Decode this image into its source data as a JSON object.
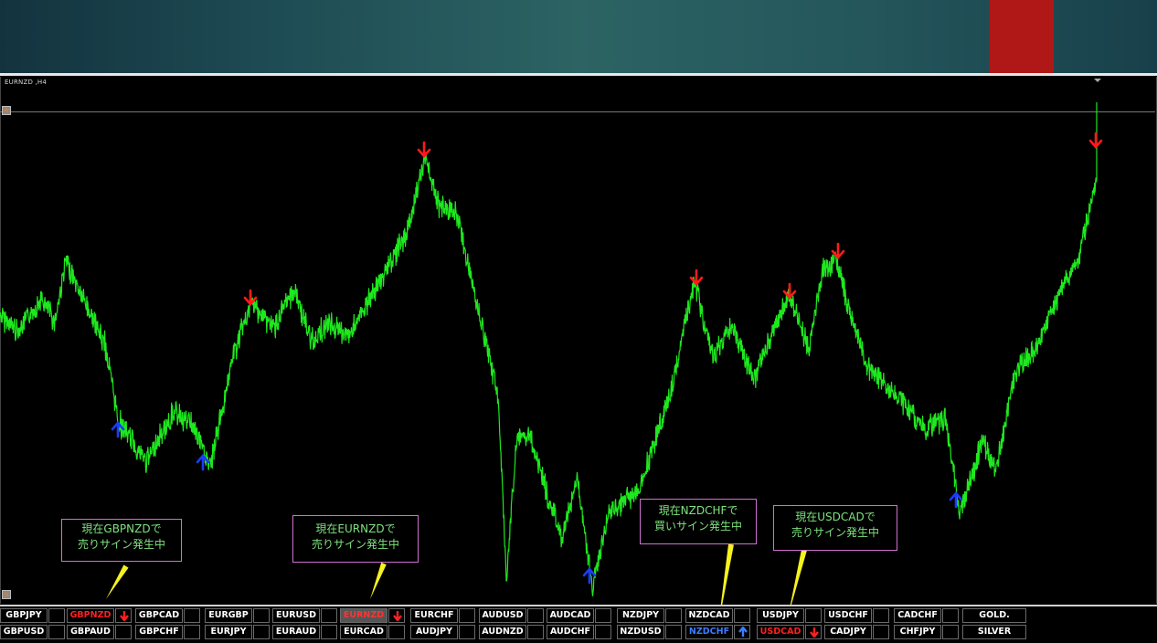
{
  "chart": {
    "title": "EURNZD ,H4",
    "line_color": "#1ee81e"
  },
  "signals": {
    "sell_color": "#ff1a1a",
    "buy_color": "#1a3cff"
  },
  "callouts": [
    {
      "line1": "現在GBPNZDで",
      "line2": "売りサイン発生中"
    },
    {
      "line1": "現在EURNZDで",
      "line2": "売りサイン発生中"
    },
    {
      "line1": "現在NZDCHFで",
      "line2": "買いサイン発生中"
    },
    {
      "line1": "現在USDCADで",
      "line2": "売りサイン発生中"
    }
  ],
  "pairs_row1": [
    {
      "label": "GBPJPY",
      "state": "none"
    },
    {
      "label": "GBPNZD",
      "state": "sell"
    },
    {
      "label": "GBPCAD",
      "state": "none"
    },
    {
      "label": "EURGBP",
      "state": "none"
    },
    {
      "label": "EURUSD",
      "state": "none"
    },
    {
      "label": "EURNZD",
      "state": "sell-active"
    },
    {
      "label": "EURCHF",
      "state": "none"
    },
    {
      "label": "AUDUSD",
      "state": "none"
    },
    {
      "label": "AUDCAD",
      "state": "none"
    },
    {
      "label": "NZDJPY",
      "state": "none"
    },
    {
      "label": "NZDCAD",
      "state": "none"
    },
    {
      "label": "USDJPY",
      "state": "none"
    },
    {
      "label": "USDCHF",
      "state": "none"
    },
    {
      "label": "CADCHF",
      "state": "none"
    },
    {
      "label": "GOLD.",
      "state": "none"
    }
  ],
  "pairs_row2": [
    {
      "label": "GBPUSD",
      "state": "none"
    },
    {
      "label": "GBPAUD",
      "state": "none"
    },
    {
      "label": "GBPCHF",
      "state": "none"
    },
    {
      "label": "EURJPY",
      "state": "none"
    },
    {
      "label": "EURAUD",
      "state": "none"
    },
    {
      "label": "EURCAD",
      "state": "none"
    },
    {
      "label": "AUDJPY",
      "state": "none"
    },
    {
      "label": "AUDNZD",
      "state": "none"
    },
    {
      "label": "AUDCHF",
      "state": "none"
    },
    {
      "label": "NZDUSD",
      "state": "none"
    },
    {
      "label": "NZDCHF",
      "state": "buy"
    },
    {
      "label": "USDCAD",
      "state": "sell"
    },
    {
      "label": "CADJPY",
      "state": "none"
    },
    {
      "label": "CHFJPY",
      "state": "none"
    },
    {
      "label": "SILVER",
      "state": "none"
    }
  ]
}
